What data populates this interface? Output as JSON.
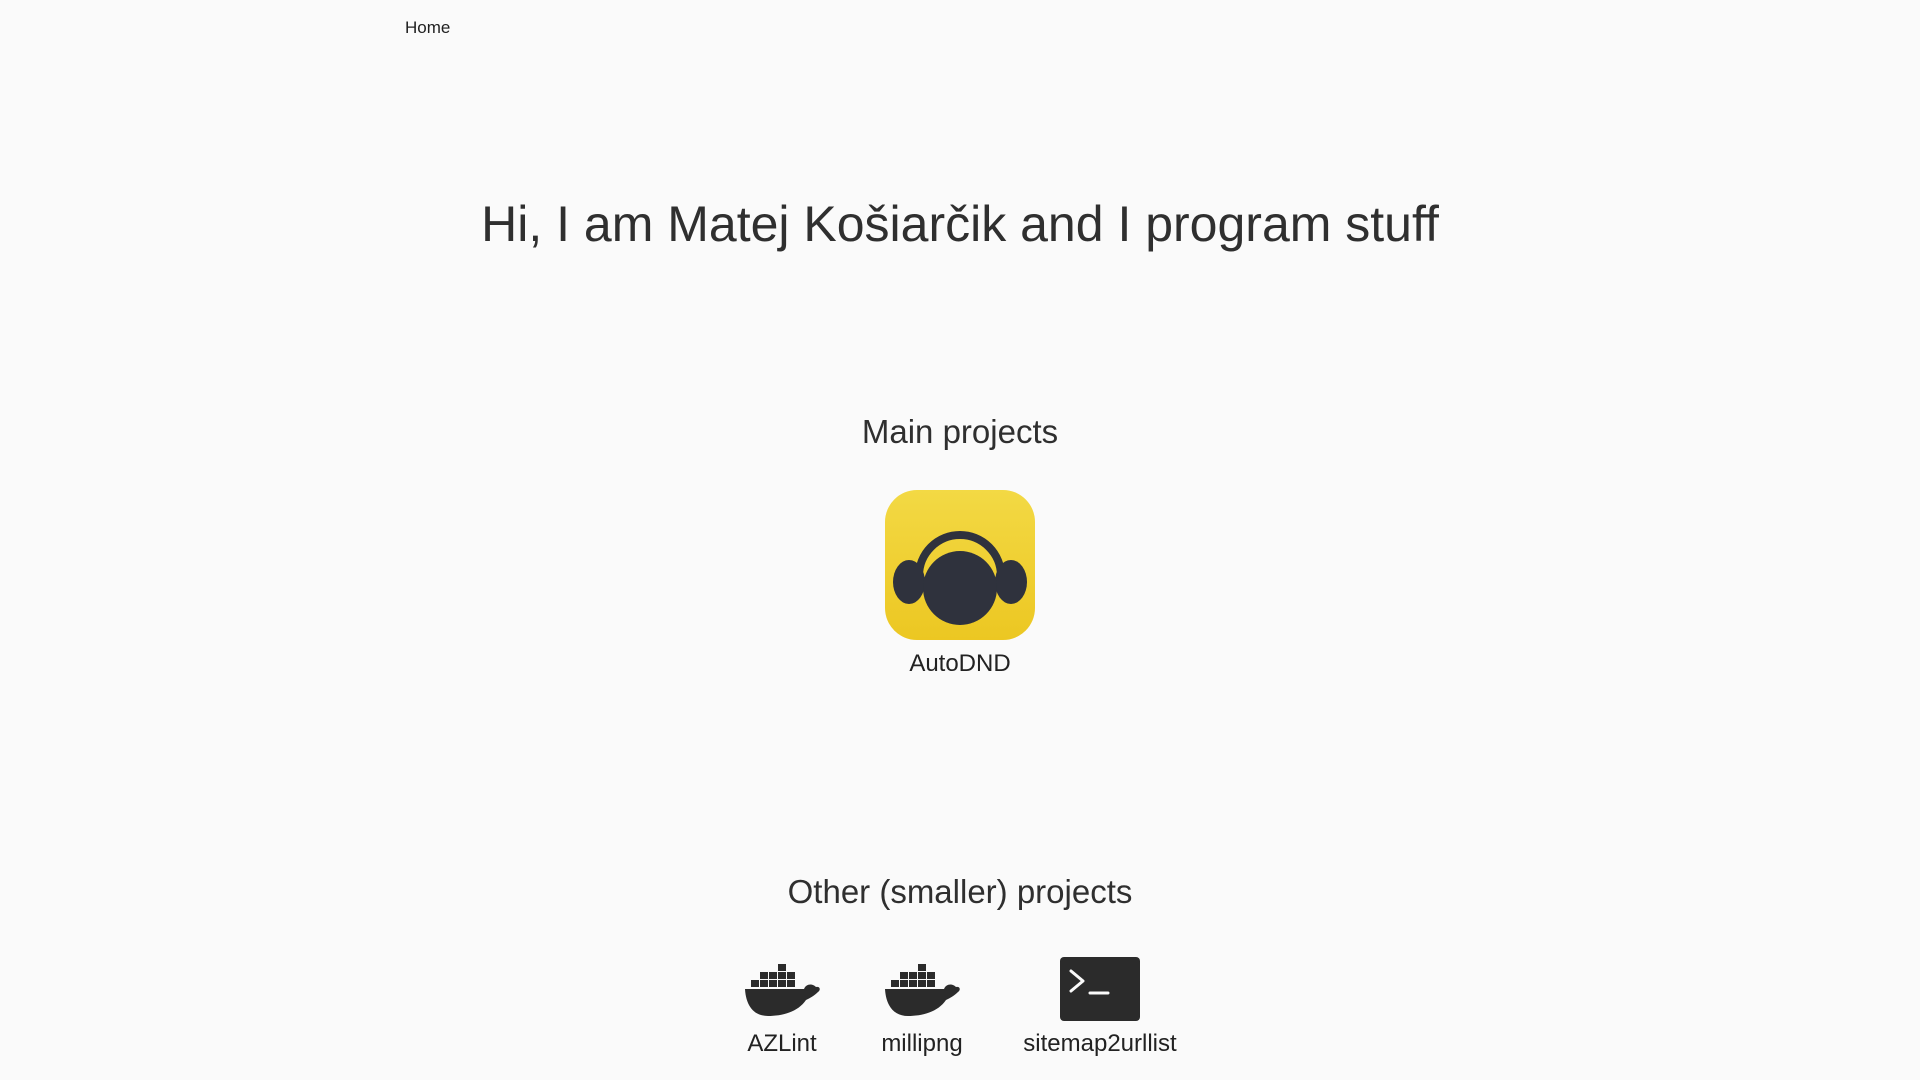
{
  "nav": {
    "home_label": "Home"
  },
  "hero": {
    "title": "Hi, I am Matej Košiarčik and I program stuff"
  },
  "main_projects": {
    "title": "Main projects",
    "items": [
      {
        "label": "AutoDND",
        "icon": "headphones-app-icon",
        "color": "#f0d030"
      }
    ]
  },
  "other_projects": {
    "title": "Other (smaller) projects",
    "items": [
      {
        "label": "AZLint",
        "icon": "docker-whale-icon"
      },
      {
        "label": "millipng",
        "icon": "docker-whale-icon"
      },
      {
        "label": "sitemap2urllist",
        "icon": "terminal-icon"
      }
    ]
  },
  "colors": {
    "background": "#fafafa",
    "text": "#2f2f2f",
    "icon_dark": "#2b2b2b",
    "autodnd_yellow": "#f0d030",
    "autodnd_dark": "#2f323d"
  }
}
